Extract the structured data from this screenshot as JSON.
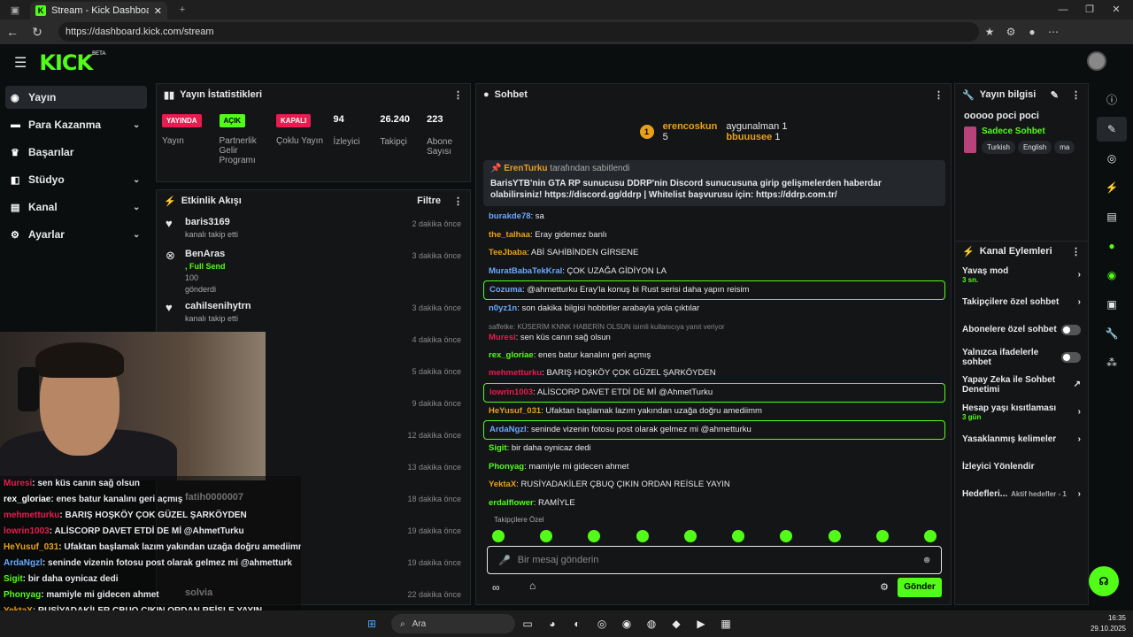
{
  "browser": {
    "tab_title": "Stream - Kick Dashboard",
    "url": "https://dashboard.kick.com/stream"
  },
  "brand": {
    "logo": "KICK",
    "beta": "BETA",
    "accent": "#53fc18"
  },
  "sidebar": {
    "items": [
      {
        "label": "Yayın",
        "icon": "broadcast-icon"
      },
      {
        "label": "Para Kazanma",
        "icon": "money-icon"
      },
      {
        "label": "Başarılar",
        "icon": "trophy-icon"
      },
      {
        "label": "Stüdyo",
        "icon": "studio-icon"
      },
      {
        "label": "Kanal",
        "icon": "channel-icon"
      },
      {
        "label": "Ayarlar",
        "icon": "gear-icon"
      }
    ]
  },
  "stats": {
    "title": "Yayın İstatistikleri",
    "cells": [
      {
        "pill": "YAYINDA",
        "label": "Yayın"
      },
      {
        "pill": "AÇIK",
        "label": "Partnerlik Gelir Programı"
      },
      {
        "pill": "KAPALI",
        "label": "Çoklu Yayın"
      },
      {
        "num": "94",
        "label": "İzleyici"
      },
      {
        "num": "26.240",
        "label": "Takipçi"
      },
      {
        "num": "223",
        "label": "Abone Sayısı"
      }
    ]
  },
  "activity": {
    "title": "Etkinlik Akışı",
    "filter": "Filtre",
    "items": [
      {
        "name": "baris3169",
        "sub": "kanalı takip etti",
        "time": "2 dakika önce"
      },
      {
        "name": "BenAras",
        "sub": ", Full Send",
        "extra": "100",
        "extra2": "gönderdi",
        "time": "3 dakika önce"
      },
      {
        "name": "cahilsenihytrn",
        "sub": "kanalı takip etti",
        "time": "3 dakika önce"
      },
      {
        "time": "4 dakika önce"
      },
      {
        "time": "5 dakika önce"
      },
      {
        "time": "9 dakika önce"
      },
      {
        "time": "12 dakika önce"
      },
      {
        "time": "13 dakika önce"
      },
      {
        "name": "fatih0000007",
        "time": "18 dakika önce"
      },
      {
        "time": "19 dakika önce"
      },
      {
        "time": "19 dakika önce"
      },
      {
        "name": "solvia",
        "time": "22 dakika önce"
      }
    ]
  },
  "overlay": [
    {
      "u": "Muresi",
      "t": ": sen küs canın sağ olsun",
      "c": "#e81c4f"
    },
    {
      "u": "rex_gloriae",
      "t": ": enes batur kanalını geri açmış",
      "c": "#fff"
    },
    {
      "u": "mehmetturku",
      "t": ": BARIŞ HOŞKÖY ÇOK GÜZEL ŞARKÖYDEN",
      "c": "#e81c4f"
    },
    {
      "u": "lowrin1003",
      "t": ": ALİSCORP DAVET ETDİ DE Mİ @AhmetTurku",
      "c": "#e81c4f"
    },
    {
      "u": "HeYusuf_031",
      "t": ": Ufaktan başlamak lazım yakından uzağa doğru amediimm",
      "c": "#e8a01c"
    },
    {
      "u": "ArdaNgzl",
      "t": ": seninde vizenin fotosu post olarak gelmez mi @ahmetturk",
      "c": "#6aa9ff"
    },
    {
      "u": "Sigit",
      "t": ": bir daha oynicaz dedi",
      "c": "#53fc18"
    },
    {
      "u": "Phonyag",
      "t": ": mamiyle mi gidecen ahmet",
      "c": "#53fc18"
    },
    {
      "u": "YektaX",
      "t": ": RUSİYADAKİLER ÇBUQ ÇIKIN ORDAN REİSLE YAYIN",
      "c": "#e8a01c"
    },
    {
      "u": "erdalflower",
      "t": ": RAMİYLE",
      "c": "#53fc18"
    }
  ],
  "chat": {
    "title": "Sohbet",
    "top": {
      "u1": "erencoskun",
      "n1": "5",
      "u2": "aygunalman",
      "n2": "1",
      "u3": "bbuuusee",
      "n3": "1"
    },
    "pinned": {
      "by": "ErenTurku",
      "by_suffix": "tarafından sabitlendi",
      "text": "BarisYTB'nin GTA RP sunucusu DDRP'nin Discord sunucusuna girip gelişmelerden haberdar olabilirsiniz! https://discord.gg/ddrp | Whitelist başvurusu için: https://ddrp.com.tr/"
    },
    "messages": [
      {
        "u": "burakde78",
        "t": ": sa",
        "c": "#6aa9ff"
      },
      {
        "u": "the_talhaa",
        "t": ": Eray gidemez banlı",
        "c": "#e8a01c"
      },
      {
        "u": "TeeJbaba",
        "t": ": ABİ SAHİBİNDEN GİRSENE",
        "c": "#e8a01c"
      },
      {
        "u": "MuratBabaTekKral",
        "t": ": ÇOK UZAĞA GİDİYON LA",
        "c": "#6aa9ff"
      },
      {
        "u": "Cozuma",
        "t": ": @ahmetturku Eray'la konuş bi Rust serisi daha yapın reisim",
        "c": "#6aa9ff",
        "hl": true
      },
      {
        "u": "n0yz1n",
        "t": ": son dakika bilgisi hobbitler arabayla yola çıktılar",
        "c": "#6aa9ff"
      },
      {
        "u": "Muresi",
        "t": ": sen küs canın sağ olsun",
        "c": "#e81c4f",
        "reply": "saffetke: KÜSERİM KNNK HABERİN OLSUN isimli kullanıcıya yanıt veriyor"
      },
      {
        "u": "rex_gloriae",
        "t": ": enes batur kanalını geri açmış",
        "c": "#53fc18"
      },
      {
        "u": "mehmetturku",
        "t": ": BARIŞ HOŞKÖY ÇOK GÜZEL ŞARKÖYDEN",
        "c": "#e81c4f"
      },
      {
        "u": "lowrin1003",
        "t": ": ALİSCORP DAVET ETDİ DE Mİ @AhmetTurku",
        "c": "#e81c4f",
        "hl": true
      },
      {
        "u": "HeYusuf_031",
        "t": ": Ufaktan başlamak lazım yakından uzağa doğru amediimm",
        "c": "#e8a01c"
      },
      {
        "u": "ArdaNgzl",
        "t": ": seninde vizenin fotosu post olarak gelmez mi @ahmetturku",
        "c": "#6aa9ff",
        "hl": true
      },
      {
        "u": "Sigit",
        "t": ": bir daha oynicaz dedi",
        "c": "#53fc18"
      },
      {
        "u": "Phonyag",
        "t": ": mamiyle mi gidecen ahmet",
        "c": "#53fc18"
      },
      {
        "u": "YektaX",
        "t": ": RUSİYADAKİLER ÇBUQ ÇIKIN ORDAN REİSLE YAYIN",
        "c": "#e8a01c"
      },
      {
        "u": "erdalflower",
        "t": ": RAMİYLE",
        "c": "#53fc18"
      }
    ],
    "followers_only": "Takipçilere Özel",
    "placeholder": "Bir mesaj gönderin",
    "send": "Gönder",
    "infinity": "∞"
  },
  "info": {
    "title": "Yayın bilgisi",
    "stream_title": "ooooo poci poci",
    "category": "Sadece Sohbet",
    "tags": [
      "Turkish",
      "English",
      "ma"
    ]
  },
  "actions": {
    "title": "Kanal Eylemleri",
    "rows": [
      {
        "l": "Yavaş mod",
        "s": "3 sn.",
        "k": "chev"
      },
      {
        "l": "Takipçilere özel sohbet",
        "k": "chev"
      },
      {
        "l": "Abonelere özel sohbet",
        "k": "toggle"
      },
      {
        "l": "Yalnızca ifadelerle sohbet",
        "k": "toggle"
      },
      {
        "l": "Yapay Zeka ile Sohbet Denetimi",
        "k": "ext"
      },
      {
        "l": "Hesap yaşı kısıtlaması",
        "s": "3 gün",
        "k": "chev"
      },
      {
        "l": "Yasaklanmış kelimeler",
        "k": "chev"
      },
      {
        "l": "İzleyici Yönlendir",
        "k": ""
      },
      {
        "l": "Hedefleri...",
        "s2": "Aktif hedefler - 1",
        "k": "chev"
      }
    ]
  },
  "taskbar": {
    "search": "Ara",
    "time": "16:35",
    "date": "29.10.2025"
  }
}
